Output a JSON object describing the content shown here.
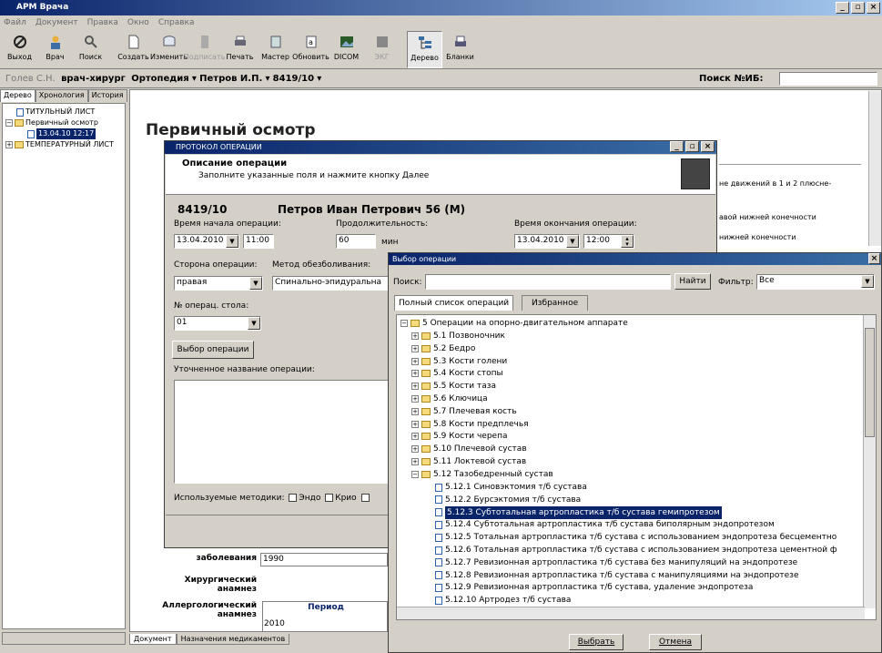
{
  "app": {
    "title": "АРМ Врача"
  },
  "menu": [
    "Файл",
    "Документ",
    "Правка",
    "Окно",
    "Справка"
  ],
  "toolbar": [
    {
      "label": "Выход",
      "icon": "exit-icon"
    },
    {
      "label": "Врач",
      "icon": "doctor-icon"
    },
    {
      "label": "Поиск",
      "icon": "search-icon"
    },
    {
      "label": "Создать",
      "icon": "new-doc-icon"
    },
    {
      "label": "Изменить",
      "icon": "edit-icon"
    },
    {
      "label": "Подписать",
      "icon": "sign-icon",
      "disabled": true
    },
    {
      "label": "Печать",
      "icon": "print-icon"
    },
    {
      "label": "Мастер",
      "icon": "wizard-icon"
    },
    {
      "label": "Обновить",
      "icon": "refresh-icon"
    },
    {
      "label": "DICOM",
      "icon": "dicom-icon"
    },
    {
      "label": "ЭКГ",
      "icon": "ecg-icon",
      "disabled": true
    },
    {
      "label": "Дерево",
      "icon": "tree-icon",
      "active": true
    },
    {
      "label": "Бланки",
      "icon": "forms-icon"
    }
  ],
  "infobar": {
    "doctor": "Голев С.Н.",
    "role": "врач-хирург",
    "dept": "Ортопедия",
    "patient": "Петров И.П.",
    "case": "8419/10",
    "search_label": "Поиск №ИБ:"
  },
  "left": {
    "tabs": [
      "Дерево",
      "Хронология",
      "История"
    ],
    "tree": [
      "ТИТУЛЬНЫЙ ЛИСТ",
      "Первичный осмотр",
      "13.04.10 12:17",
      "ТЕМПЕРАТУРНЫЙ ЛИСТ"
    ]
  },
  "main": {
    "title": "Первичный осмотр",
    "lines": [
      "не движений в 1 и 2 плюсне-",
      "авой нижней конечности",
      "нижней конечности"
    ],
    "labels": {
      "since": "заболевания",
      "since_value": "1990",
      "surgical": "Хирургический анамнез",
      "allergy": "Аллергологический анамнез",
      "period": "Период",
      "allergy_value": "2010"
    }
  },
  "bottom_tabs": [
    "Документ",
    "Назначения медикаментов"
  ],
  "protocol": {
    "title": "ПРОТОКОЛ ОПЕРАЦИИ",
    "heading": "Описание операции",
    "hint": "Заполните указанные поля и нажмите кнопку Далее",
    "case": "8419/10",
    "patient": "Петров Иван Петрович  56 (М)",
    "start_label": "Время начала операции:",
    "start_date": "13.04.2010",
    "start_time": "11:00",
    "duration_label": "Продолжительность:",
    "duration": "60",
    "duration_unit": "мин",
    "end_label": "Время окончания операции:",
    "end_date": "13.04.2010",
    "end_time": "12:00",
    "side_label": "Сторона операции:",
    "side": "правая",
    "anesth_label": "Метод обезболивания:",
    "anesth": "Спинально-эпидуральна",
    "table_label": "№ операц. стола:",
    "table": "01",
    "select_btn": "Выбор операции",
    "clarified_label": "Уточненное название операции:",
    "methods_label": "Используемые методики:",
    "methods": [
      "Эндо",
      "Крио"
    ]
  },
  "selector": {
    "title": "Выбор операции",
    "search_label": "Поиск:",
    "find_btn": "Найти",
    "filter_label": "Фильтр:",
    "filter": "Все",
    "tabs": [
      "Полный список операций",
      "Избранное"
    ],
    "root": "5 Операции на опорно-двигательном аппарате",
    "groups": [
      "5.1 Позвоночник",
      "5.2 Бедро",
      "5.3 Кости голени",
      "5.4 Кости стопы",
      "5.5 Кости таза",
      "5.6 Ключица",
      "5.7 Плечевая кость",
      "5.8 Кости предплечья",
      "5.9 Кости черепа",
      "5.10 Плечевой сустав",
      "5.11 Локтевой сустав",
      "5.12 Тазобедренный сустав"
    ],
    "items": [
      "5.12.1  Синовэктомия т/б сустава",
      "5.12.2  Бурсэктомия т/б сустава",
      "5.12.3  Субтотальная артропластика т/б сустава гемипротезом",
      "5.12.4  Субтотальная артропластика т/б сустава биполярным эндопротезом",
      "5.12.5  Тотальная артропластика т/б сустава с использованием эндопротеза бесцементно",
      "5.12.6  Тотальная артропластика т/б сустава с использованием эндопротеза цементной ф",
      "5.12.7  Ревизионная артропластика т/б сустава без манипуляций на эндопротезе",
      "5.12.8  Ревизионная артропластика т/б сустава с манипуляциями на эндопротезе",
      "5.12.9  Ревизионная артропластика т/б сустава, удаление эндопротеза",
      "5.12.10  Артродез т/б сустава"
    ],
    "ok_btn": "Выбрать",
    "cancel_btn": "Отмена"
  }
}
